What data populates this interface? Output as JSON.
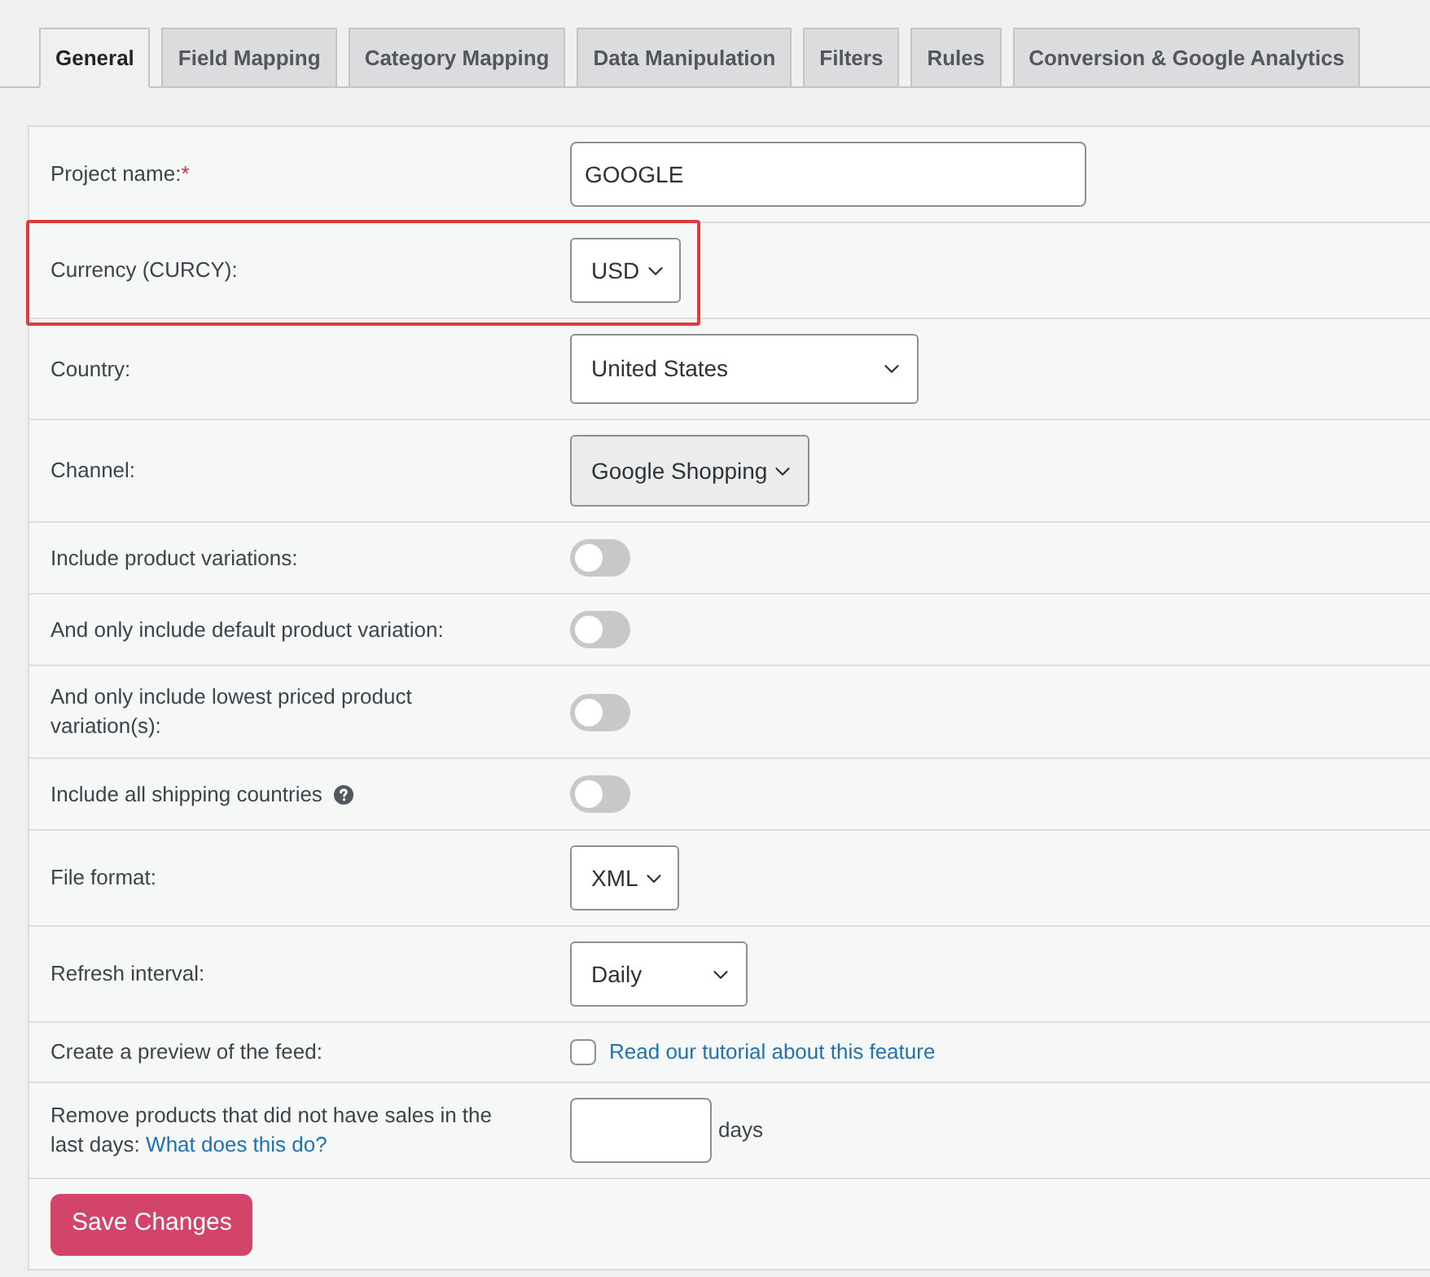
{
  "tabs": [
    {
      "label": "General",
      "selected": true
    },
    {
      "label": "Field Mapping",
      "selected": false
    },
    {
      "label": "Category Mapping",
      "selected": false
    },
    {
      "label": "Data Manipulation",
      "selected": false
    },
    {
      "label": "Filters",
      "selected": false
    },
    {
      "label": "Rules",
      "selected": false
    },
    {
      "label": "Conversion & Google Analytics",
      "selected": false
    }
  ],
  "form": {
    "rows": [
      {
        "kind": "text",
        "label": "Project name:",
        "required_mark": "*",
        "value": "GOOGLE",
        "highlighted": false
      },
      {
        "kind": "select",
        "label": "Currency (CURCY):",
        "value": "USD",
        "disabled": false,
        "highlighted": true
      },
      {
        "kind": "select",
        "label": "Country:",
        "value": "United States",
        "disabled": false,
        "highlighted": false
      },
      {
        "kind": "select",
        "label": "Channel:",
        "value": "Google Shopping",
        "disabled": true,
        "highlighted": false
      },
      {
        "kind": "toggle",
        "label": "Include product variations:",
        "on": false,
        "help": false,
        "highlighted": false
      },
      {
        "kind": "toggle",
        "label": "And only include default product variation:",
        "on": false,
        "help": false,
        "highlighted": false
      },
      {
        "kind": "toggle",
        "label": "And only include lowest priced product variation(s):",
        "on": false,
        "help": false,
        "highlighted": false
      },
      {
        "kind": "toggle",
        "label": "Include all shipping countries",
        "on": false,
        "help": true,
        "highlighted": false
      },
      {
        "kind": "select",
        "label": "File format:",
        "value": "XML",
        "disabled": false,
        "highlighted": false
      },
      {
        "kind": "select",
        "label": "Refresh interval:",
        "value": "Daily",
        "disabled": false,
        "highlighted": false
      },
      {
        "kind": "checkbox",
        "label": "Create a preview of the feed:",
        "checked": false,
        "link": "Read our tutorial about this feature",
        "highlighted": false
      },
      {
        "kind": "number",
        "label": "Remove products that did not have sales in the last days:",
        "label_link": "What does this do?",
        "unit": "days",
        "highlighted": false
      }
    ]
  },
  "save_button": {
    "label": "Save Changes"
  }
}
